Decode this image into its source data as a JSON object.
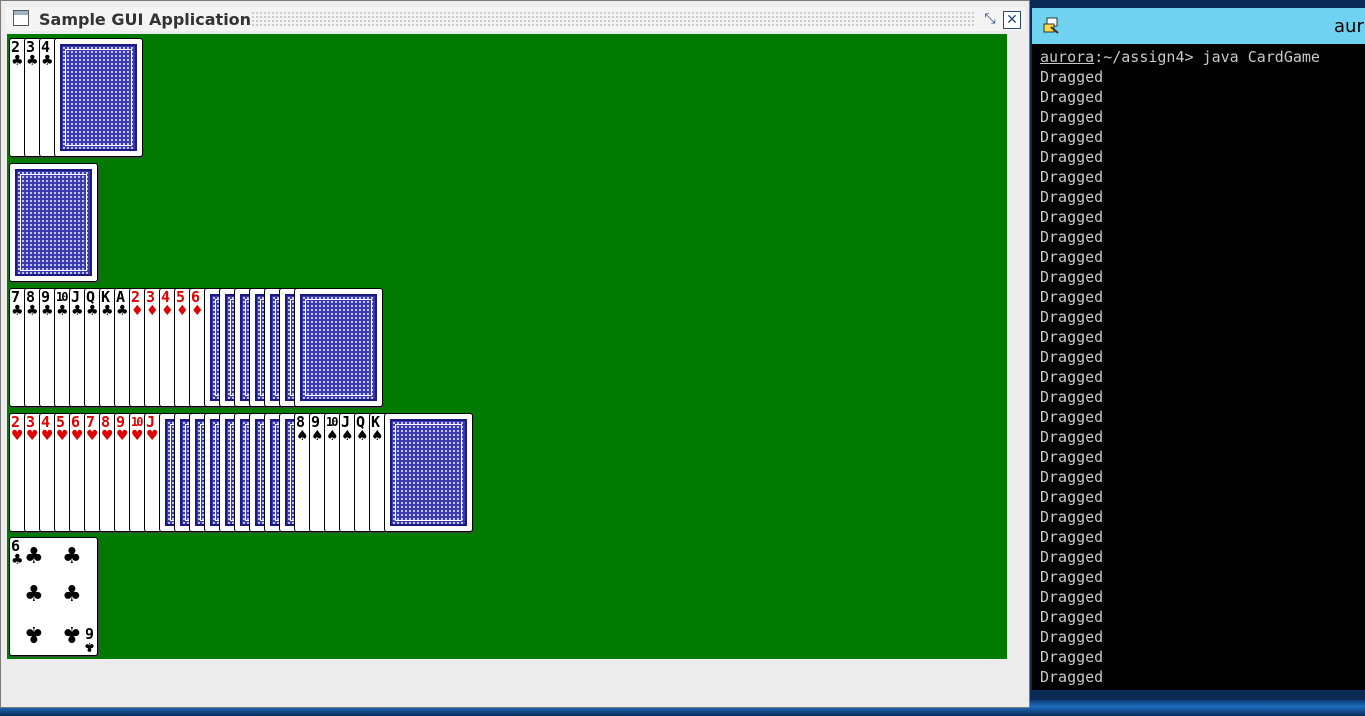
{
  "java_window": {
    "title": "Sample GUI Application",
    "restore_icon": "restore-icon",
    "close_icon": "close-icon",
    "table_color": "#017a02"
  },
  "rows": {
    "row1": {
      "face_cards": [
        {
          "rank": "2",
          "suit": "♣",
          "color": "black"
        },
        {
          "rank": "3",
          "suit": "♣",
          "color": "black"
        },
        {
          "rank": "4",
          "suit": "♣",
          "color": "black"
        }
      ],
      "back_count": 0,
      "trailing_back": true
    },
    "row2": {
      "face_cards": [],
      "back_count": 0,
      "trailing_back": true
    },
    "row3": {
      "face_cards": [
        {
          "rank": "7",
          "suit": "♣",
          "color": "black"
        },
        {
          "rank": "8",
          "suit": "♣",
          "color": "black"
        },
        {
          "rank": "9",
          "suit": "♣",
          "color": "black"
        },
        {
          "rank": "10",
          "suit": "♣",
          "color": "black"
        },
        {
          "rank": "J",
          "suit": "♣",
          "color": "black"
        },
        {
          "rank": "Q",
          "suit": "♣",
          "color": "black"
        },
        {
          "rank": "K",
          "suit": "♣",
          "color": "black"
        },
        {
          "rank": "A",
          "suit": "♣",
          "color": "black"
        },
        {
          "rank": "2",
          "suit": "♦",
          "color": "red"
        },
        {
          "rank": "3",
          "suit": "♦",
          "color": "red"
        },
        {
          "rank": "4",
          "suit": "♦",
          "color": "red"
        },
        {
          "rank": "5",
          "suit": "♦",
          "color": "red"
        },
        {
          "rank": "6",
          "suit": "♦",
          "color": "red"
        }
      ],
      "back_count": 6,
      "trailing_back": true
    },
    "row4": {
      "face_cards": [
        {
          "rank": "2",
          "suit": "♥",
          "color": "red"
        },
        {
          "rank": "3",
          "suit": "♥",
          "color": "red"
        },
        {
          "rank": "4",
          "suit": "♥",
          "color": "red"
        },
        {
          "rank": "5",
          "suit": "♥",
          "color": "red"
        },
        {
          "rank": "6",
          "suit": "♥",
          "color": "red"
        },
        {
          "rank": "7",
          "suit": "♥",
          "color": "red"
        },
        {
          "rank": "8",
          "suit": "♥",
          "color": "red"
        },
        {
          "rank": "9",
          "suit": "♥",
          "color": "red"
        },
        {
          "rank": "10",
          "suit": "♥",
          "color": "red"
        },
        {
          "rank": "J",
          "suit": "♥",
          "color": "red"
        }
      ],
      "back_count": 9,
      "tail_face_cards": [
        {
          "rank": "8",
          "suit": "♠",
          "color": "black"
        },
        {
          "rank": "9",
          "suit": "♠",
          "color": "black"
        },
        {
          "rank": "10",
          "suit": "♠",
          "color": "black"
        },
        {
          "rank": "J",
          "suit": "♠",
          "color": "black"
        },
        {
          "rank": "Q",
          "suit": "♠",
          "color": "black"
        },
        {
          "rank": "K",
          "suit": "♠",
          "color": "black"
        }
      ],
      "trailing_back": true
    },
    "row5": {
      "single_card": {
        "rank": "6",
        "suit": "♣",
        "color": "black"
      }
    }
  },
  "terminal": {
    "title": "aur",
    "icon": "putty-icon",
    "prompt_host": "aurora",
    "prompt_rest": ":~/assign4> java CardGame",
    "output_lines": [
      "Dragged",
      "Dragged",
      "Dragged",
      "Dragged",
      "Dragged",
      "Dragged",
      "Dragged",
      "Dragged",
      "Dragged",
      "Dragged",
      "Dragged",
      "Dragged",
      "Dragged",
      "Dragged",
      "Dragged",
      "Dragged",
      "Dragged",
      "Dragged",
      "Dragged",
      "Dragged",
      "Dragged",
      "Dragged",
      "Dragged",
      "Dragged",
      "Dragged",
      "Dragged",
      "Dragged",
      "Dragged",
      "Dragged",
      "Dragged",
      "Dragged"
    ]
  }
}
